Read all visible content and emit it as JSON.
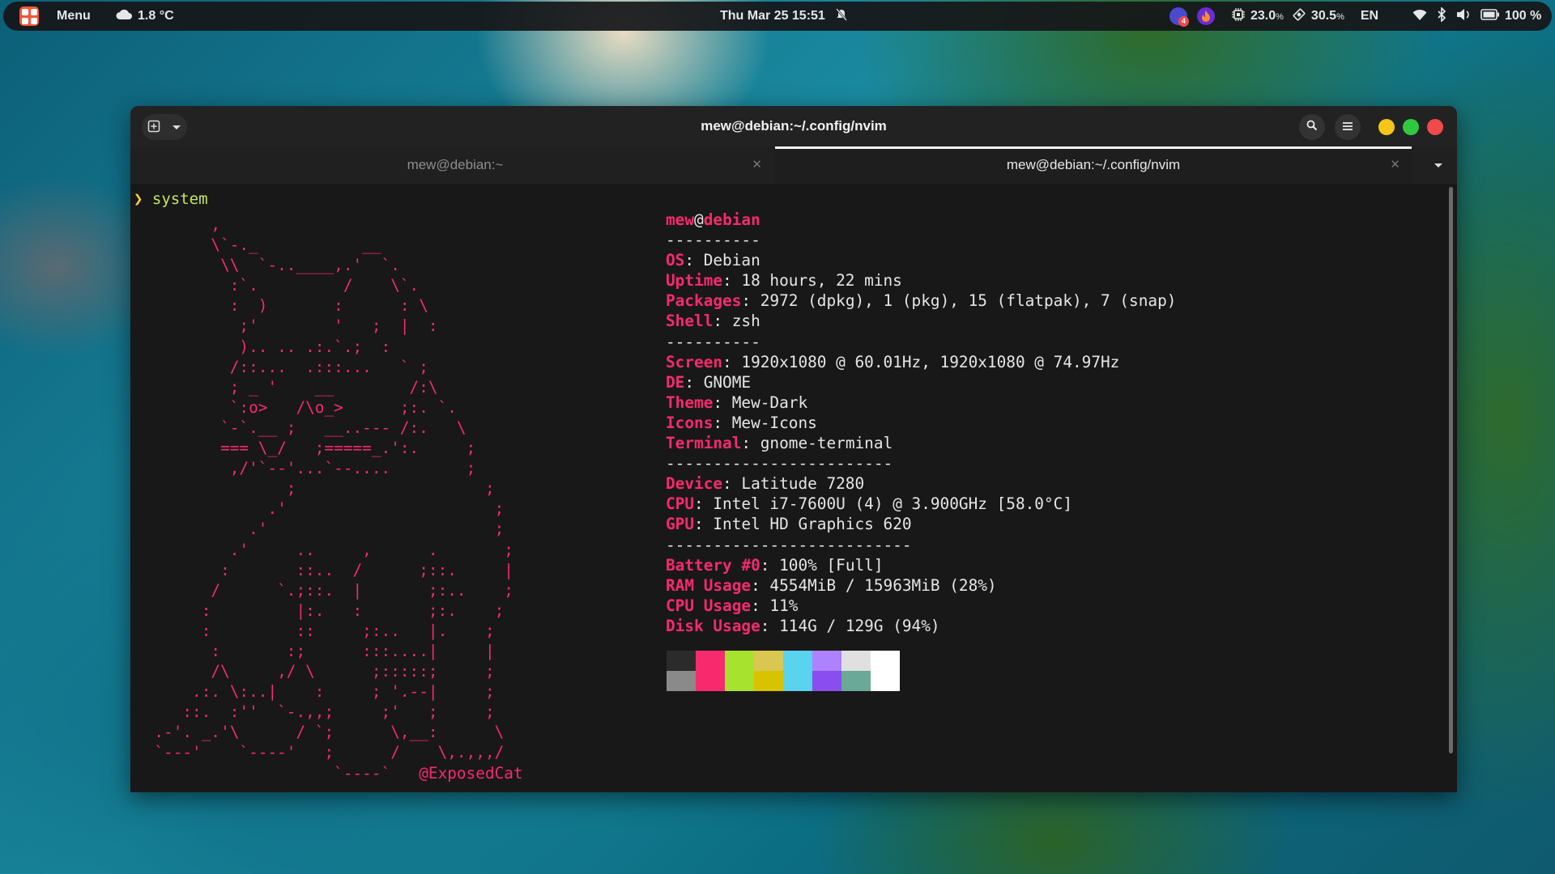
{
  "topbar": {
    "menu_label": "Menu",
    "weather": "1.8 °C",
    "clock": "Thu Mar 25  15:51",
    "cpu_value": "23.0",
    "cpu_unit": "%",
    "mem_value": "30.5",
    "mem_unit": "%",
    "language": "EN",
    "battery": "100 %",
    "notif_badge": "4"
  },
  "window": {
    "title": "mew@debian:~/.config/nvim",
    "tabs": [
      {
        "label": "mew@debian:~"
      },
      {
        "label": "mew@debian:~/.config/nvim"
      }
    ]
  },
  "terminal": {
    "prompt_symbol": "❯",
    "command": "system",
    "ascii_art": "        ,\n        \\`-._           __\n         \\\\  `-..____,.'  `.\n          :`.         /    \\`.\n          :  )       :      : \\\n           ;'        '   ;  |  :\n           ).. .. .:.`.;  :\n          /::...  .:::...   ` ;\n          ; _ '    __        /:\\\n          `:o>   /\\o_>      ;:. `.\n         `-`.__ ;   __..--- /:.   \\\n         === \\_/   ;=====_.':.     ;\n          ,/'`--'...`--....        ;\n                ;                    ;\n              .'                      ;\n            .'                        ;\n          .'     ..     ,      .       ;\n         :       ::..  /      ;::.     |\n        /      `.;::.  |       ;:..    ;\n       :         |:.   :       ;:.    ;\n       :         ::     ;:..   |.    ;\n        :       :;      :::....|     |\n        /\\     ,/ \\      ;:::::;     ;\n      .:. \\:..|    :     ; '.--|     ;\n     ::.  :''  `-.,,;     ;'   ;     ;\n  .-'. _.'\\      / `;      \\,__:      \\\n  `---'    `----'   ;      /    \\,.,,,/\n                     `----`   @ExposedCat",
    "info": [
      {
        "user": "mew",
        "at": "@",
        "host": "debian"
      },
      {
        "text": "----------"
      },
      {
        "key": "OS",
        "value": ": Debian"
      },
      {
        "key": "Uptime",
        "value": ": 18 hours, 22 mins"
      },
      {
        "key": "Packages",
        "value": ": 2972 (dpkg), 1 (pkg), 15 (flatpak), 7 (snap)"
      },
      {
        "key": "Shell",
        "value": ": zsh"
      },
      {
        "text": "----------"
      },
      {
        "key": "Screen",
        "value": ": 1920x1080 @ 60.01Hz, 1920x1080 @ 74.97Hz"
      },
      {
        "key": "DE",
        "value": ": GNOME"
      },
      {
        "key": "Theme",
        "value": ": Mew-Dark"
      },
      {
        "key": "Icons",
        "value": ": Mew-Icons"
      },
      {
        "key": "Terminal",
        "value": ": gnome-terminal"
      },
      {
        "text": "------------------------"
      },
      {
        "key": "Device",
        "value": ": Latitude 7280"
      },
      {
        "key": "CPU",
        "value": ": Intel i7-7600U (4) @ 3.900GHz [58.0°C]"
      },
      {
        "key": "GPU",
        "value": ": Intel HD Graphics 620"
      },
      {
        "text": "--------------------------"
      },
      {
        "key": "Battery #0",
        "value": ": 100% [Full]"
      },
      {
        "key": "RAM Usage",
        "value": ": 4554MiB / 15963MiB (28%)"
      },
      {
        "key": "CPU Usage",
        "value": ": 11%"
      },
      {
        "key": "Disk Usage",
        "value": ": 114G / 129G (94%)"
      }
    ],
    "palette_top": [
      "#2b2b2b",
      "#f72a6d",
      "#a6e22e",
      "#d9c752",
      "#59d3ee",
      "#ae81ff",
      "#e0e0e0",
      "#ffffff"
    ],
    "palette_bottom": [
      "#8a8a8a",
      "#f72a6d",
      "#a6e22e",
      "#d9c200",
      "#59d3ee",
      "#8a4df0",
      "#6aa898",
      "#ffffff"
    ]
  },
  "colors": {
    "accent_pink": "#f72a6d",
    "prompt_green": "#c3e85b",
    "traffic_yellow": "#f5c518",
    "traffic_green": "#31c841",
    "traffic_red": "#f04a4a"
  }
}
